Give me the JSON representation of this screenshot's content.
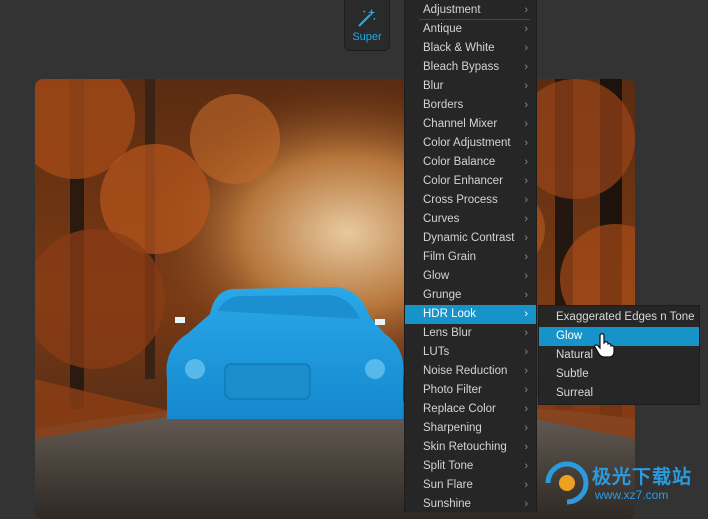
{
  "toolbar": {
    "super_label": "Super",
    "super_icon": "magic-wand-icon",
    "accent": "#23a9e6"
  },
  "menu": {
    "items": [
      {
        "label": "Adjustment"
      },
      {
        "label": "Antique"
      },
      {
        "label": "Black & White"
      },
      {
        "label": "Bleach Bypass"
      },
      {
        "label": "Blur"
      },
      {
        "label": "Borders"
      },
      {
        "label": "Channel Mixer"
      },
      {
        "label": "Color Adjustment"
      },
      {
        "label": "Color Balance"
      },
      {
        "label": "Color Enhancer"
      },
      {
        "label": "Cross Process"
      },
      {
        "label": "Curves"
      },
      {
        "label": "Dynamic Contrast"
      },
      {
        "label": "Film Grain"
      },
      {
        "label": "Glow"
      },
      {
        "label": "Grunge"
      },
      {
        "label": "HDR Look"
      },
      {
        "label": "Lens Blur"
      },
      {
        "label": "LUTs"
      },
      {
        "label": "Noise Reduction"
      },
      {
        "label": "Photo Filter"
      },
      {
        "label": "Replace Color"
      },
      {
        "label": "Sharpening"
      },
      {
        "label": "Skin Retouching"
      },
      {
        "label": "Split Tone"
      },
      {
        "label": "Sun Flare"
      },
      {
        "label": "Sunshine"
      }
    ],
    "active_label": "HDR Look",
    "highlight_color": "#1693c9"
  },
  "submenu": {
    "items": [
      {
        "label": "Exaggerated Edges n Tone"
      },
      {
        "label": "Glow"
      },
      {
        "label": "Natural"
      },
      {
        "label": "Subtle"
      },
      {
        "label": "Surreal"
      }
    ],
    "active_label": "Glow"
  },
  "watermark": {
    "title": "极光下载站",
    "url": "www.xz7.com"
  }
}
